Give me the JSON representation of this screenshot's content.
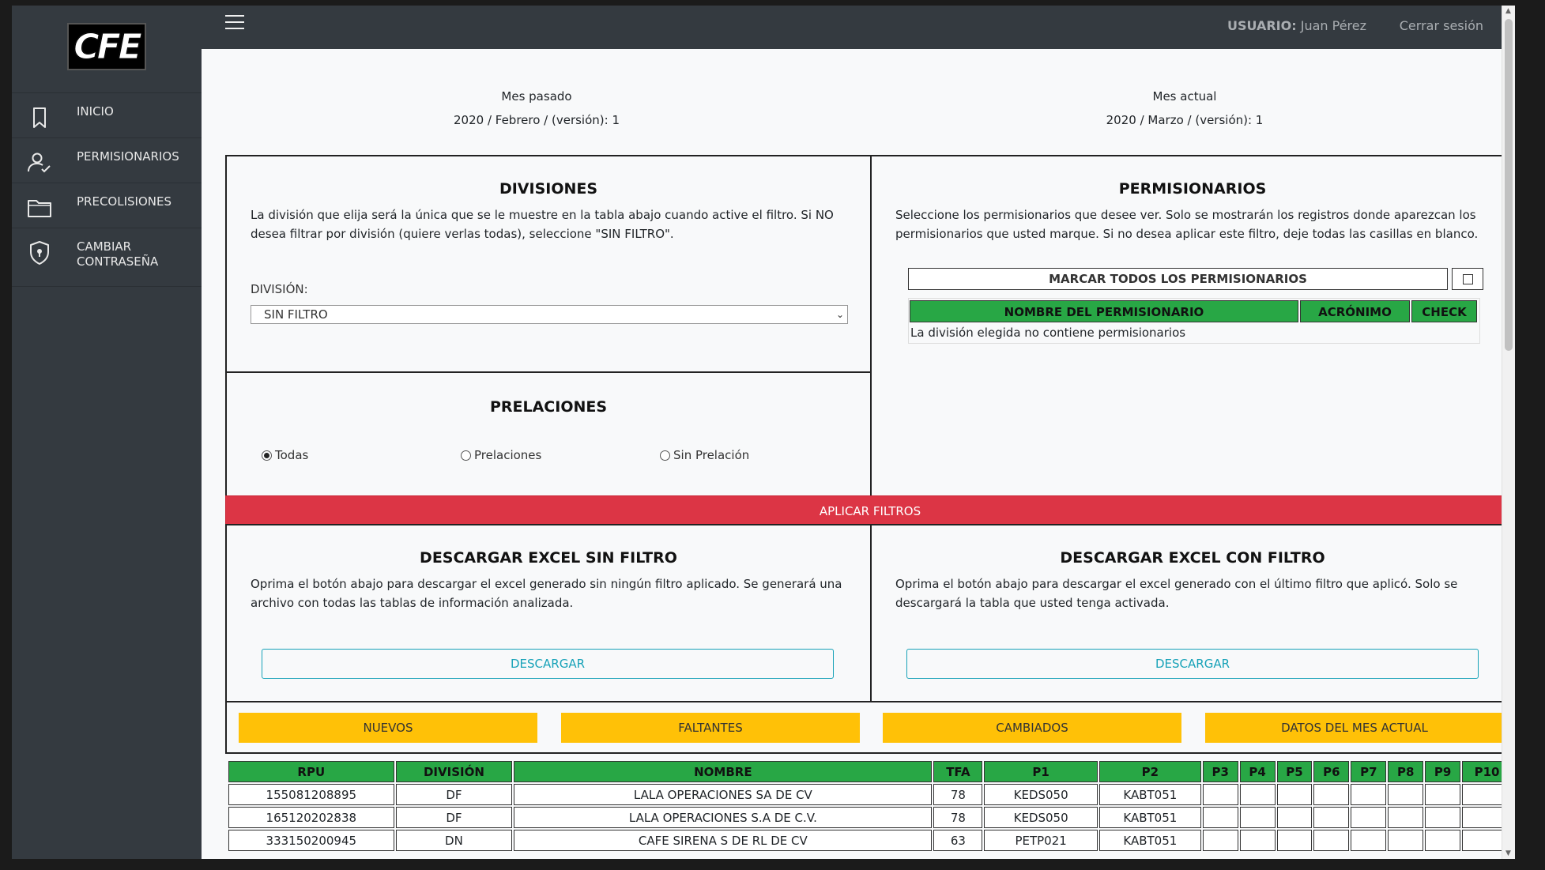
{
  "logo_text": "CFE",
  "sidebar": {
    "items": [
      {
        "label": "INICIO",
        "icon": "bookmark-icon"
      },
      {
        "label": "PERMISIONARIOS",
        "icon": "user-check-icon"
      },
      {
        "label": "PRECOLISIONES",
        "icon": "folder-icon"
      },
      {
        "label": "CAMBIAR\nCONTRASEÑA",
        "icon": "shield-lock-icon"
      }
    ]
  },
  "topbar": {
    "user_label": "USUARIO:",
    "user_name": "Juan Pérez",
    "logout": "Cerrar sesión"
  },
  "months": {
    "past_label": "Mes pasado",
    "past_value": "2020 / Febrero / (versión): 1",
    "current_label": "Mes actual",
    "current_value": "2020 / Marzo / (versión): 1"
  },
  "divisiones": {
    "title": "DIVISIONES",
    "desc": "La división que elija será la única que se le muestre en la tabla abajo cuando active el filtro. Si NO desea filtrar por división (quiere verlas todas), seleccione \"SIN FILTRO\".",
    "field_label": "DIVISIÓN:",
    "selected": "SIN FILTRO"
  },
  "prelaciones": {
    "title": "PRELACIONES",
    "options": [
      "Todas",
      "Prelaciones",
      "Sin Prelación"
    ],
    "selected_index": 0
  },
  "permisionarios": {
    "title": "PERMISIONARIOS",
    "desc": "Seleccione los permisionarios que desee ver. Solo se mostrarán los registros donde aparezcan los permisionarios que usted marque. Si no desea aplicar este filtro, deje todas las casillas en blanco.",
    "mark_all": "MARCAR TODOS LOS PERMISIONARIOS",
    "columns": [
      "NOMBRE DEL PERMISIONARIO",
      "ACRÓNIMO",
      "CHECK"
    ],
    "empty_message": "La división elegida no contiene permisionarios"
  },
  "apply_button": "APLICAR FILTROS",
  "excel_sin": {
    "title": "DESCARGAR EXCEL SIN FILTRO",
    "desc": "Oprima el botón abajo para descargar el excel generado sin ningún filtro aplicado. Se generará una archivo con todas las tablas de información analizada.",
    "button": "DESCARGAR"
  },
  "excel_con": {
    "title": "DESCARGAR EXCEL CON FILTRO",
    "desc": "Oprima el botón abajo para descargar el excel generado con el último filtro que aplicó. Solo se descargará la tabla que usted tenga activada.",
    "button": "DESCARGAR"
  },
  "tabs": [
    "NUEVOS",
    "FALTANTES",
    "CAMBIADOS",
    "DATOS DEL MES ACTUAL"
  ],
  "table": {
    "columns": [
      "RPU",
      "DIVISIÓN",
      "NOMBRE",
      "TFA",
      "P1",
      "P2",
      "P3",
      "P4",
      "P5",
      "P6",
      "P7",
      "P8",
      "P9",
      "P10"
    ],
    "rows": [
      [
        "155081208895",
        "DF",
        "LALA OPERACIONES SA DE CV",
        "78",
        "KEDS050",
        "KABT051",
        "",
        "",
        "",
        "",
        "",
        "",
        "",
        ""
      ],
      [
        "165120202838",
        "DF",
        "LALA OPERACIONES S.A DE C.V.",
        "78",
        "KEDS050",
        "KABT051",
        "",
        "",
        "",
        "",
        "",
        "",
        "",
        ""
      ],
      [
        "333150200945",
        "DN",
        "CAFE SIRENA S DE RL DE CV",
        "63",
        "PETP021",
        "KABT051",
        "",
        "",
        "",
        "",
        "",
        "",
        "",
        ""
      ]
    ]
  },
  "colors": {
    "sidebar_bg": "#343a40",
    "header_green": "#28a745",
    "apply_red": "#dc3545",
    "tab_yellow": "#ffc107",
    "download_teal": "#17a2b8"
  }
}
